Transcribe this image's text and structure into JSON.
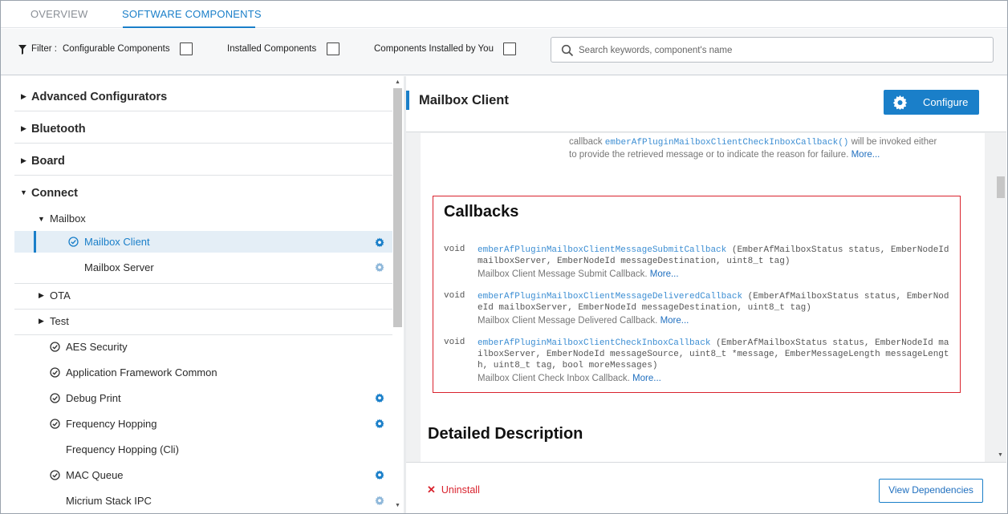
{
  "tabs": [
    {
      "label": "OVERVIEW",
      "active": false
    },
    {
      "label": "SOFTWARE COMPONENTS",
      "active": true
    }
  ],
  "filter": {
    "label": "Filter :",
    "options": [
      {
        "label": "Configurable Components",
        "checked": false
      },
      {
        "label": "Installed Components",
        "checked": false
      },
      {
        "label": "Components Installed by You",
        "checked": false
      }
    ],
    "search_placeholder": "Search keywords, component's name"
  },
  "tree": {
    "categories": [
      {
        "label": "Advanced Configurators",
        "expanded": false
      },
      {
        "label": "Bluetooth",
        "expanded": false
      },
      {
        "label": "Board",
        "expanded": false
      },
      {
        "label": "Connect",
        "expanded": true
      }
    ],
    "subgroups": [
      {
        "label": "Mailbox",
        "expanded": true
      },
      {
        "label": "OTA",
        "expanded": false
      },
      {
        "label": "Test",
        "expanded": false
      }
    ],
    "mailbox_items": [
      {
        "label": "Mailbox Client",
        "installed": true,
        "configurable": true,
        "selected": true
      },
      {
        "label": "Mailbox Server",
        "installed": false,
        "configurable": true,
        "selected": false
      }
    ],
    "components": [
      {
        "label": "AES Security",
        "installed": true,
        "configurable": false
      },
      {
        "label": "Application Framework Common",
        "installed": true,
        "configurable": false
      },
      {
        "label": "Debug Print",
        "installed": true,
        "configurable": true
      },
      {
        "label": "Frequency Hopping",
        "installed": true,
        "configurable": true
      },
      {
        "label": "Frequency Hopping (Cli)",
        "installed": false,
        "configurable": false
      },
      {
        "label": "MAC Queue",
        "installed": true,
        "configurable": true
      },
      {
        "label": "Micrium Stack IPC",
        "installed": false,
        "configurable": true
      }
    ]
  },
  "detail": {
    "title": "Mailbox Client",
    "configure_label": "Configure",
    "partial_desc": {
      "prefix": "callback ",
      "link": "emberAfPluginMailboxClientCheckInboxCallback()",
      "suffix": " will be invoked either to provide the retrieved message or to indicate the reason for failure. ",
      "more": "More..."
    },
    "callbacks_title": "Callbacks",
    "callbacks": [
      {
        "ret": "void",
        "name": "emberAfPluginMailboxClientMessageSubmitCallback",
        "params": " (EmberAfMailboxStatus status, EmberNodeId mailboxServer, EmberNodeId messageDestination, uint8_t tag)",
        "desc": "Mailbox Client Message Submit Callback.",
        "more": "More..."
      },
      {
        "ret": "void",
        "name": "emberAfPluginMailboxClientMessageDeliveredCallback",
        "params": " (EmberAfMailboxStatus status, EmberNodeId mailboxServer, EmberNodeId messageDestination, uint8_t tag)",
        "desc": "Mailbox Client Message Delivered Callback.",
        "more": "More..."
      },
      {
        "ret": "void",
        "name": "emberAfPluginMailboxClientCheckInboxCallback",
        "params": " (EmberAfMailboxStatus status, EmberNodeId mailboxServer, EmberNodeId messageSource, uint8_t *message, EmberMessageLength messageLength, uint8_t tag, bool moreMessages)",
        "desc": "Mailbox Client Check Inbox Callback.",
        "more": "More..."
      }
    ],
    "detailed_title": "Detailed Description",
    "uninstall_label": "Uninstall",
    "view_deps_label": "View Dependencies"
  },
  "colors": {
    "accent": "#1a7fc9",
    "danger": "#d9232e",
    "link": "#3c8ed3"
  }
}
